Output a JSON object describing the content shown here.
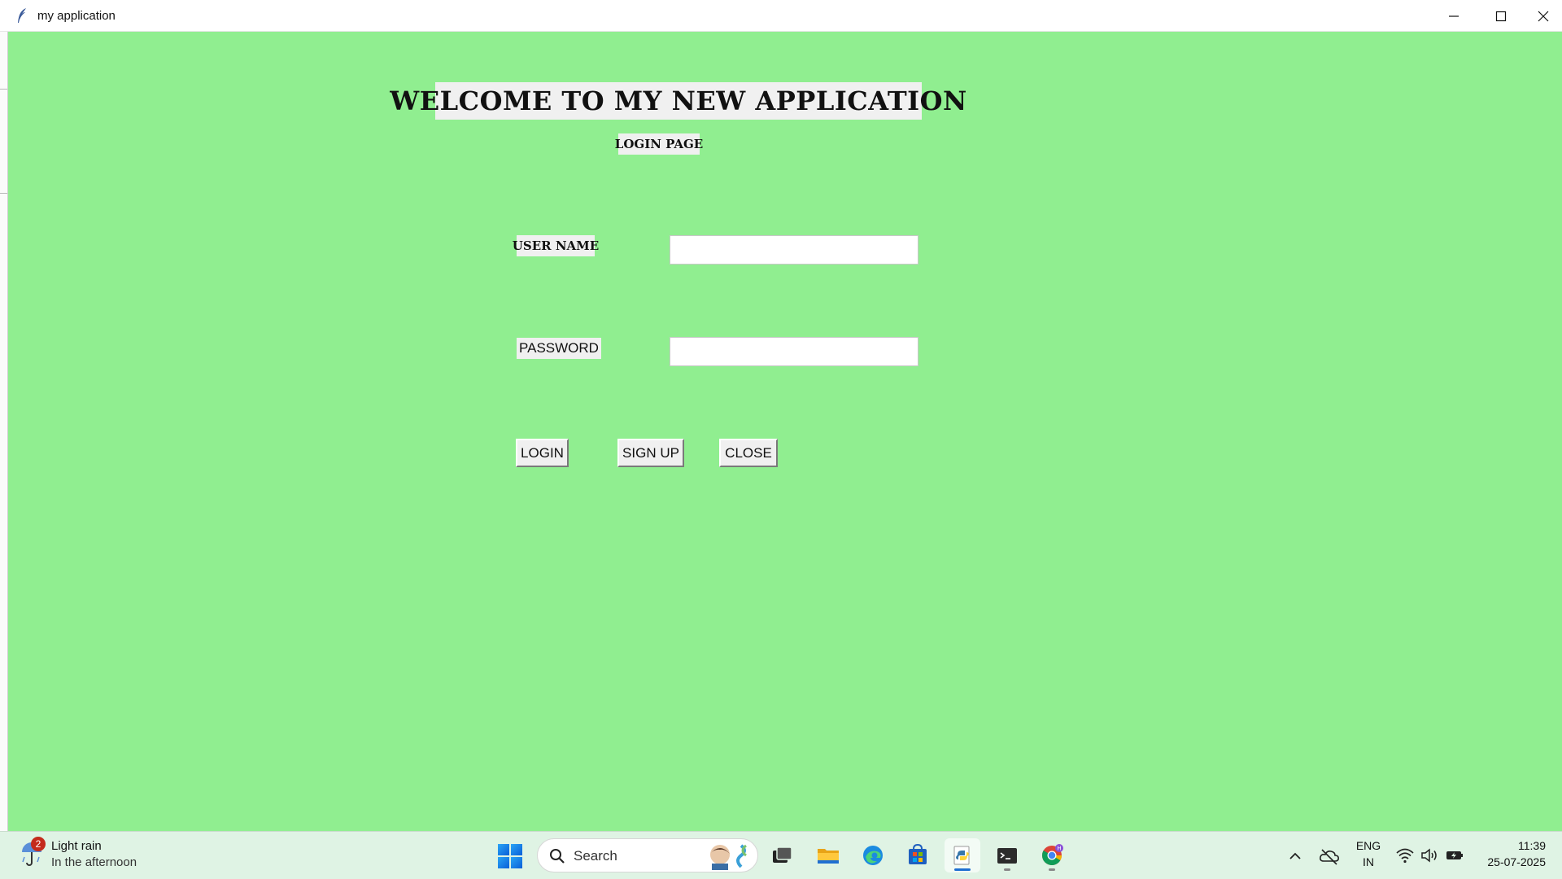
{
  "window": {
    "title": "my application"
  },
  "app": {
    "background_color": "#90ee90",
    "heading": "WELCOME TO MY NEW APPLICATION",
    "subheading": "LOGIN PAGE",
    "username_label": "USER NAME",
    "username_value": "",
    "password_label": "PASSWORD",
    "password_value": "",
    "buttons": {
      "login": "LOGIN",
      "signup": "SIGN UP",
      "close": "CLOSE"
    }
  },
  "taskbar": {
    "weather": {
      "badge": "2",
      "title": "Light rain",
      "subtitle": "In the afternoon",
      "icon": "umbrella-icon"
    },
    "search_placeholder": "Search",
    "pinned": [
      {
        "name": "start-icon"
      },
      {
        "name": "task-view-icon"
      },
      {
        "name": "file-explorer-icon"
      },
      {
        "name": "edge-icon"
      },
      {
        "name": "store-icon"
      },
      {
        "name": "python-idle-icon",
        "active": true
      },
      {
        "name": "terminal-icon",
        "running": true
      },
      {
        "name": "chrome-icon",
        "running": true,
        "badge": "H"
      }
    ],
    "tray": {
      "language_line1": "ENG",
      "language_line2": "IN",
      "time": "11:39",
      "date": "25-07-2025"
    }
  }
}
